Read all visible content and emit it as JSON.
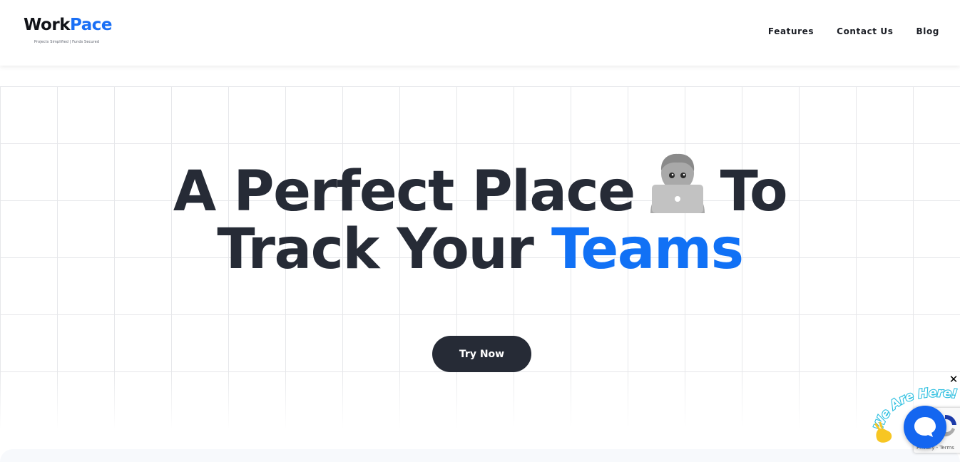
{
  "header": {
    "logo": {
      "word_work": "Work",
      "word_pace": "Pace",
      "tagline": "Projects Simplified | Funds Secured"
    },
    "nav": [
      {
        "label": "Features"
      },
      {
        "label": "Contact Us"
      },
      {
        "label": "Blog"
      }
    ]
  },
  "hero": {
    "line1_start": "A Perfect Place",
    "line1_emoji": "person-with-laptop-icon",
    "line1_end": "To",
    "line2_start": "Track Your",
    "line2_accent": "Teams",
    "cta_label": "Try Now"
  },
  "chat_widget": {
    "badge_text": "We Are Here!",
    "close_symbol": "✕",
    "recaptcha_text": "Privacy - Terms"
  },
  "colors": {
    "brand_blue": "#1171f5",
    "text_dark": "#262b36",
    "cta_bg": "#262b36",
    "chat_blue": "#1466f0"
  }
}
